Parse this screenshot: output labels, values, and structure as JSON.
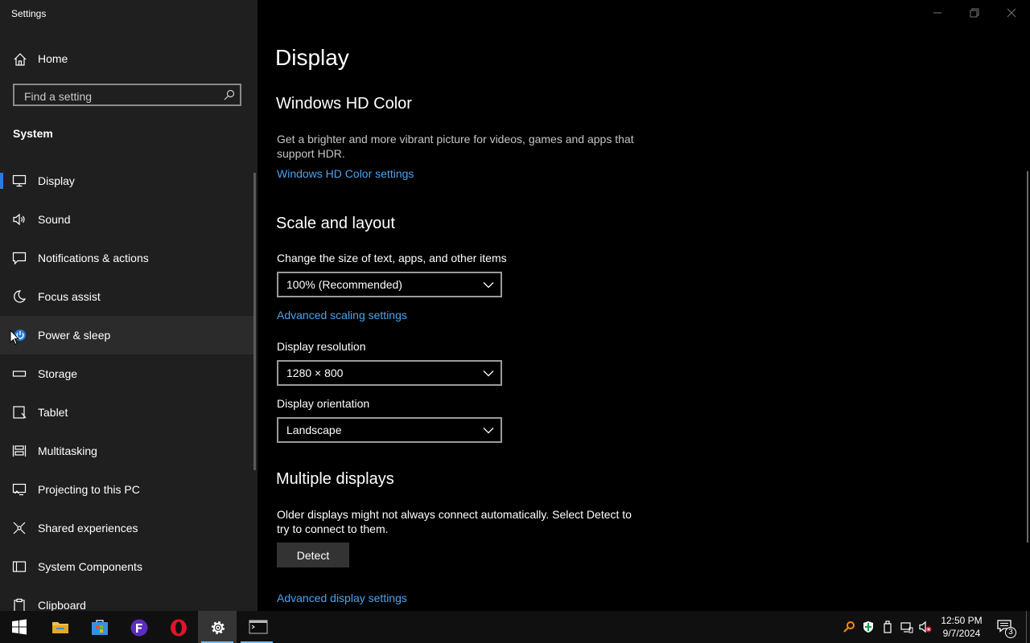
{
  "window": {
    "title": "Settings"
  },
  "sidebar": {
    "home_label": "Home",
    "search_placeholder": "Find a setting",
    "section_label": "System",
    "items": [
      {
        "label": "Display",
        "icon": "monitor-icon",
        "selected": true
      },
      {
        "label": "Sound",
        "icon": "speaker-icon"
      },
      {
        "label": "Notifications & actions",
        "icon": "message-icon"
      },
      {
        "label": "Focus assist",
        "icon": "moon-icon"
      },
      {
        "label": "Power & sleep",
        "icon": "power-icon",
        "hovered": true
      },
      {
        "label": "Storage",
        "icon": "storage-icon"
      },
      {
        "label": "Tablet",
        "icon": "tablet-icon"
      },
      {
        "label": "Multitasking",
        "icon": "multitasking-icon"
      },
      {
        "label": "Projecting to this PC",
        "icon": "projecting-icon"
      },
      {
        "label": "Shared experiences",
        "icon": "shared-icon"
      },
      {
        "label": "System Components",
        "icon": "components-icon"
      },
      {
        "label": "Clipboard",
        "icon": "clipboard-icon"
      }
    ]
  },
  "main": {
    "title": "Display",
    "hdr": {
      "heading": "Windows HD Color",
      "description": "Get a brighter and more vibrant picture for videos, games and apps that support HDR.",
      "link": "Windows HD Color settings"
    },
    "scale": {
      "heading": "Scale and layout",
      "size_label": "Change the size of text, apps, and other items",
      "size_value": "100% (Recommended)",
      "advanced_link": "Advanced scaling settings",
      "resolution_label": "Display resolution",
      "resolution_value": "1280 × 800",
      "orientation_label": "Display orientation",
      "orientation_value": "Landscape"
    },
    "multiple": {
      "heading": "Multiple displays",
      "description": "Older displays might not always connect automatically. Select Detect to try to connect to them.",
      "detect_label": "Detect",
      "advanced_link": "Advanced display settings"
    }
  },
  "taskbar": {
    "apps": [
      "start-icon",
      "file-explorer-icon",
      "store-icon",
      "f-app-icon",
      "opera-icon",
      "settings-icon",
      "terminal-icon"
    ],
    "time": "12:50 PM",
    "date": "9/7/2024",
    "notification_count": "3"
  },
  "colors": {
    "accent": "#2a7be0",
    "link": "#4aa3f0",
    "sidebar_bg": "#1f1f1f"
  }
}
